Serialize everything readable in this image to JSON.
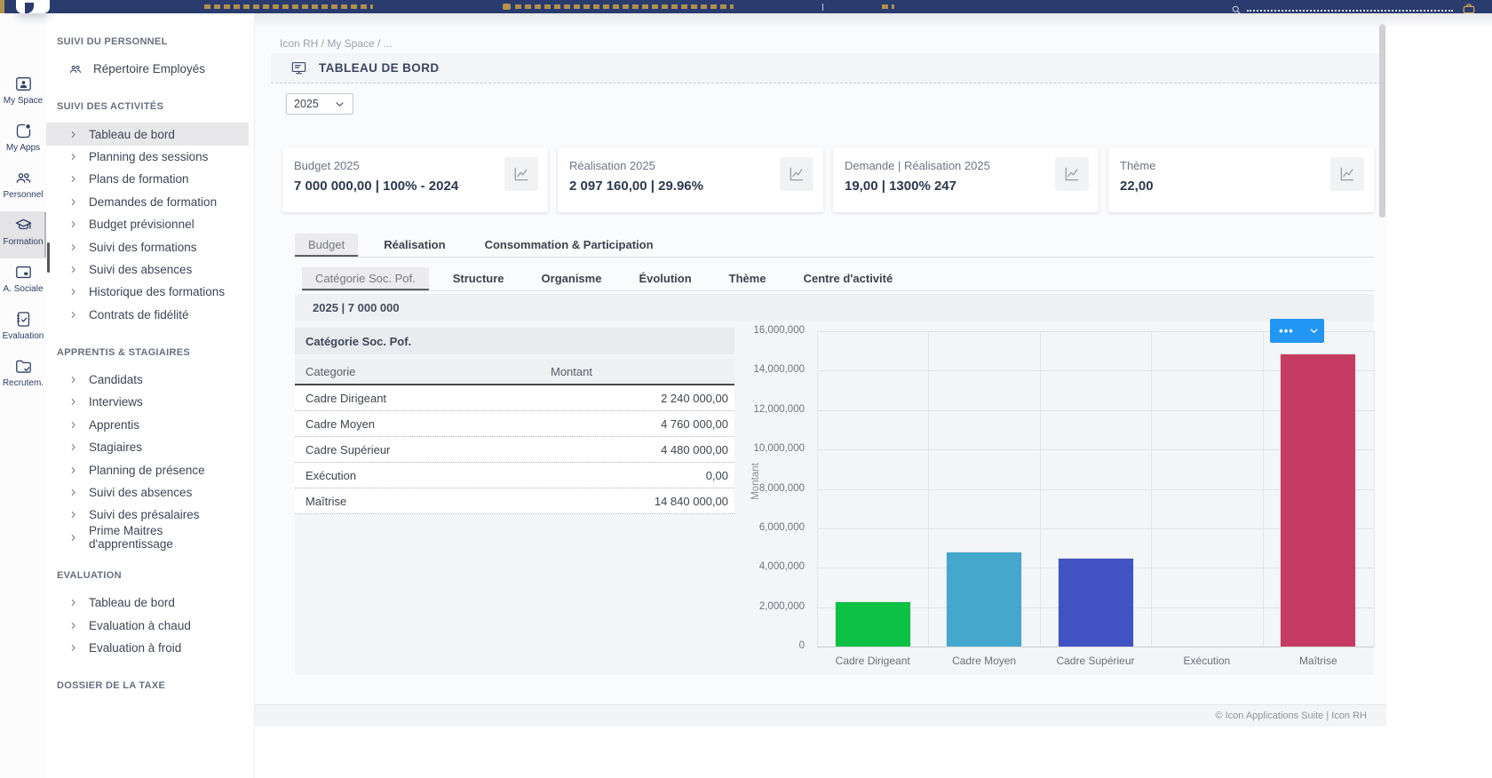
{
  "topbar": {
    "search_icon": "search-icon",
    "bag_icon": "briefcase-icon"
  },
  "breadcrumb": "Icon RH / My Space / ...",
  "page": {
    "title": "TABLEAU DE BORD",
    "title_icon": "dashboard-screen-icon",
    "year": "2025"
  },
  "rail": {
    "items": [
      {
        "label": "My Space",
        "icon": "badge-user",
        "selected": false
      },
      {
        "label": "My Apps",
        "icon": "apps",
        "selected": false
      },
      {
        "label": "Personnel",
        "icon": "people",
        "selected": false
      },
      {
        "label": "Formation",
        "icon": "graduation",
        "selected": true
      },
      {
        "label": "A. Sociale",
        "icon": "card",
        "selected": false
      },
      {
        "label": "Evaluation",
        "icon": "checklist",
        "selected": false
      },
      {
        "label": "Recrutem.",
        "icon": "folder-check",
        "selected": false
      }
    ]
  },
  "sidebar": {
    "sections": [
      {
        "title": "SUIVI DU PERSONNEL",
        "items": [
          {
            "label": "Répertoire Employés",
            "icon": "people"
          }
        ]
      },
      {
        "title": "SUIVI DES ACTIVITÉS",
        "items": [
          {
            "label": "Tableau de bord",
            "selected": true
          },
          {
            "label": "Planning des sessions"
          },
          {
            "label": "Plans de formation"
          },
          {
            "label": "Demandes de formation"
          },
          {
            "label": "Budget prévisionnel"
          },
          {
            "label": "Suivi des formations"
          },
          {
            "label": "Suivi des absences"
          },
          {
            "label": "Historique des formations"
          },
          {
            "label": "Contrats de fidélité"
          }
        ]
      },
      {
        "title": "APPRENTIS & STAGIAIRES",
        "items": [
          {
            "label": "Candidats"
          },
          {
            "label": "Interviews"
          },
          {
            "label": "Apprentis"
          },
          {
            "label": "Stagiaires"
          },
          {
            "label": "Planning de présence"
          },
          {
            "label": "Suivi des absences"
          },
          {
            "label": "Suivi des présalaires"
          },
          {
            "label": "Prime Maitres d'apprentissage"
          }
        ]
      },
      {
        "title": "EVALUATION",
        "items": [
          {
            "label": "Tableau de bord"
          },
          {
            "label": "Evaluation à chaud"
          },
          {
            "label": "Evaluation à froid"
          }
        ]
      },
      {
        "title": "DOSSIER DE LA TAXE",
        "items": []
      }
    ]
  },
  "cards": [
    {
      "label": "Budget 2025",
      "value": "7 000 000,00 | 100% - 2024"
    },
    {
      "label": "Réalisation 2025",
      "value": "2 097 160,00 | 29.96%"
    },
    {
      "label": "Demande | Réalisation 2025",
      "value": "19,00 | 1300% 247"
    },
    {
      "label": "Thème",
      "value": "22,00"
    }
  ],
  "tabs": [
    {
      "label": "Budget",
      "active": true
    },
    {
      "label": "Réalisation",
      "active": false
    },
    {
      "label": "Consommation & Participation",
      "active": false
    }
  ],
  "subtabs": [
    {
      "label": "Catégorie Soc. Pof.",
      "active": true
    },
    {
      "label": "Structure",
      "active": false
    },
    {
      "label": "Organisme",
      "active": false
    },
    {
      "label": "Évolution",
      "active": false
    },
    {
      "label": "Thème",
      "active": false
    },
    {
      "label": "Centre d'activité",
      "active": false
    }
  ],
  "panel": {
    "header": "2025 | 7 000 000",
    "menu": {
      "dots": "•••"
    },
    "table": {
      "title": "Catégorie Soc. Pof.",
      "columns": [
        "Categorie",
        "Montant"
      ],
      "rows": [
        [
          "Cadre Dirigeant",
          "2 240 000,00"
        ],
        [
          "Cadre Moyen",
          "4 760 000,00"
        ],
        [
          "Cadre Supérieur",
          "4 480 000,00"
        ],
        [
          "Exécution",
          "0,00"
        ],
        [
          "Maîtrise",
          "14 840 000,00"
        ]
      ]
    }
  },
  "chart_data": {
    "type": "bar",
    "title": "",
    "categories": [
      "Cadre Dirigeant",
      "Cadre Moyen",
      "Cadre Supérieur",
      "Exécution",
      "Maîtrise"
    ],
    "values": [
      2240000,
      4760000,
      4480000,
      0,
      14840000
    ],
    "colors": [
      "#0cc044",
      "#43a8cc",
      "#4152c3",
      "#999999",
      "#c63b61"
    ],
    "xlabel": "",
    "ylabel": "Montant",
    "ylim": [
      0,
      16000000
    ],
    "ytick_labels": [
      "0",
      "2,000,000",
      "4,000,000",
      "6,000,000",
      "8,000,000",
      "10,000,000",
      "12,000,000",
      "14,000,000",
      "16,000,000"
    ],
    "grid": true,
    "legend": false
  },
  "footer": "© Icon Applications Suite | Icon RH"
}
